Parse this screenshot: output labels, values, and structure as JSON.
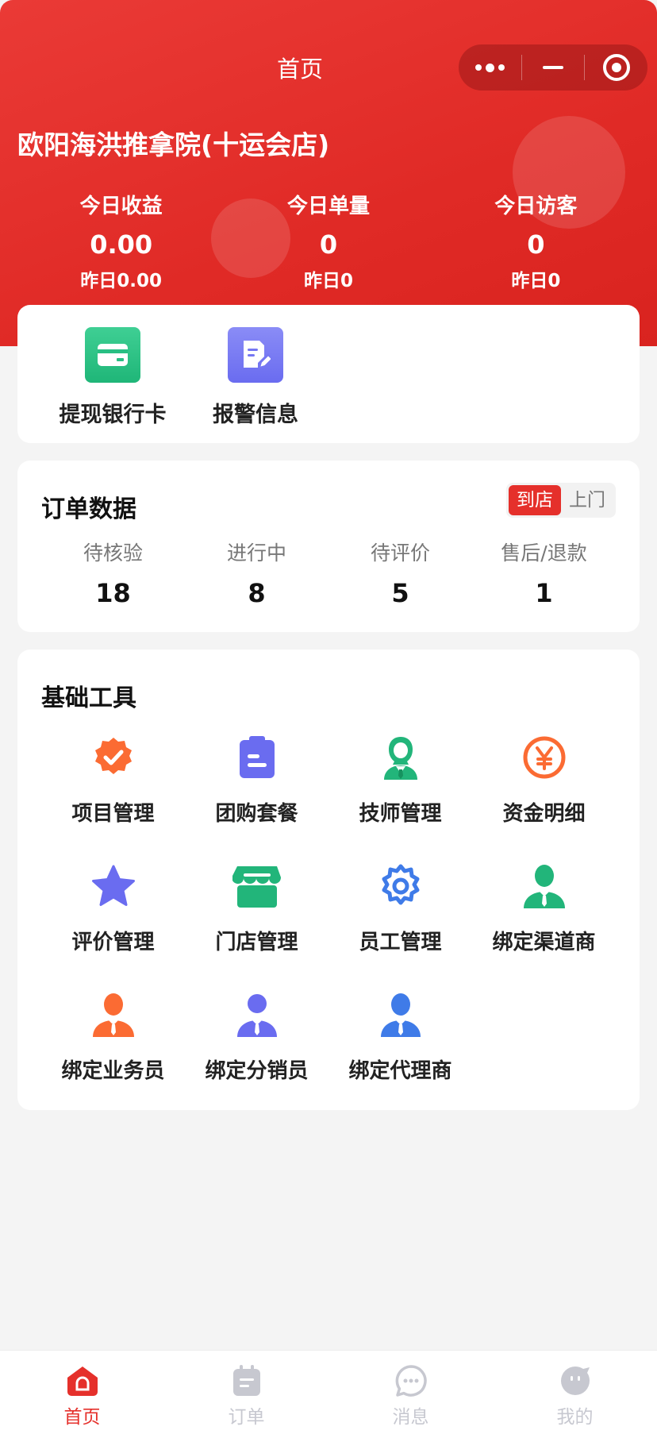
{
  "colors": {
    "brand_red": "#e5302b",
    "background": "#f4f4f4"
  },
  "nav": {
    "title": "首页"
  },
  "store": {
    "name": "欧阳海洪推拿院(十运会店)"
  },
  "stats": [
    {
      "label": "今日收益",
      "value": "0.00",
      "yesterday": "昨日0.00"
    },
    {
      "label": "今日单量",
      "value": "0",
      "yesterday": "昨日0"
    },
    {
      "label": "今日访客",
      "value": "0",
      "yesterday": "昨日0"
    }
  ],
  "quick": [
    {
      "label": "提现银行卡",
      "icon": "bank-card-icon"
    },
    {
      "label": "报警信息",
      "icon": "edit-note-icon"
    }
  ],
  "orders": {
    "title": "订单数据",
    "toggle": [
      "到店",
      "上门"
    ],
    "items": [
      {
        "label": "待核验",
        "value": "18"
      },
      {
        "label": "进行中",
        "value": "8"
      },
      {
        "label": "待评价",
        "value": "5"
      },
      {
        "label": "售后/退款",
        "value": "1"
      }
    ]
  },
  "tools": {
    "title": "基础工具",
    "items": [
      {
        "label": "项目管理",
        "icon": "badge-check-icon"
      },
      {
        "label": "团购套餐",
        "icon": "clipboard-icon"
      },
      {
        "label": "技师管理",
        "icon": "technician-icon"
      },
      {
        "label": "资金明细",
        "icon": "yuan-coin-icon"
      },
      {
        "label": "评价管理",
        "icon": "star-icon"
      },
      {
        "label": "门店管理",
        "icon": "storefront-icon"
      },
      {
        "label": "员工管理",
        "icon": "gear-icon"
      },
      {
        "label": "绑定渠道商",
        "icon": "person-tie-icon"
      },
      {
        "label": "绑定业务员",
        "icon": "person-tie-icon"
      },
      {
        "label": "绑定分销员",
        "icon": "person-tie-icon"
      },
      {
        "label": "绑定代理商",
        "icon": "person-tie-icon"
      }
    ]
  },
  "tabbar": [
    {
      "label": "首页",
      "icon": "home-icon",
      "active": true
    },
    {
      "label": "订单",
      "icon": "order-icon",
      "active": false
    },
    {
      "label": "消息",
      "icon": "message-icon",
      "active": false
    },
    {
      "label": "我的",
      "icon": "profile-icon",
      "active": false
    }
  ]
}
